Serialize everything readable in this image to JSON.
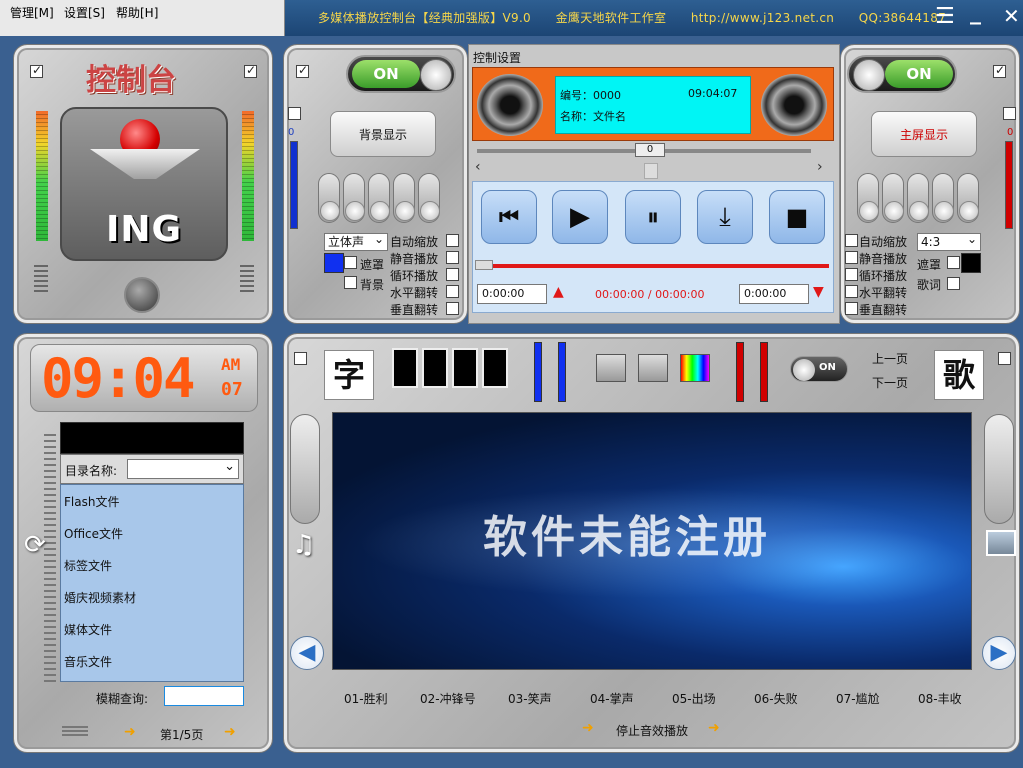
{
  "menu": {
    "manage": "管理[M]",
    "settings": "设置[S]",
    "help": "帮助[H]"
  },
  "title": "多媒体播放控制台【经典加强版】V9.0　　金鹰天地软件工作室　　http://www.j123.net.cn　　QQ:38644187",
  "window_controls": {
    "menu": "☰",
    "minimize": "_",
    "close": "✕"
  },
  "console": {
    "title": "控制台",
    "logo_text": "ING"
  },
  "master": {
    "toggle_left": "ON",
    "toggle_right": "ON",
    "bg_display": "背景显示",
    "main_display": "主屏显示",
    "vol_left": "0",
    "vol_right": "0"
  },
  "control_settings": {
    "tab_label": "控制设置",
    "number_label": "编号：0000",
    "time_display": "09:04:07",
    "name_label": "名称：文件名",
    "seek_value": "0",
    "progress_text": "00:00:00 / 00:00:00",
    "start_time": "0:00:00",
    "end_time": "0:00:00",
    "scroll_left": "‹",
    "scroll_right": "›",
    "transport": {
      "prev": "⏮",
      "play": "▶",
      "pause": "⏸",
      "download": "⤓",
      "stop": "■"
    }
  },
  "left_options": {
    "audio_mode": "立体声",
    "mask": "遮罩",
    "background": "背景",
    "auto_zoom": "自动缩放",
    "mute": "静音播放",
    "loop": "循环播放",
    "flip_h": "水平翻转",
    "flip_v": "垂直翻转"
  },
  "right_options": {
    "aspect": "4:3",
    "mask": "遮罩",
    "lyrics": "歌词",
    "auto_zoom": "自动缩放",
    "mute": "静音播放",
    "loop": "循环播放",
    "flip_h": "水平翻转",
    "flip_v": "垂直翻转"
  },
  "clock": {
    "time": "09:04",
    "ampm": "AM",
    "seconds": "07"
  },
  "directory": {
    "label": "目录名称:",
    "items": [
      "Flash文件",
      "Office文件",
      "标签文件",
      "婚庆视频素材",
      "媒体文件",
      "音乐文件"
    ],
    "search_label": "模糊查询:",
    "page": "第1/5页"
  },
  "stage": {
    "char_left": "字",
    "char_right": "歌",
    "prev_page": "上一页",
    "next_page": "下一页",
    "toggle": "ON",
    "screen_text": "软件未能注册",
    "sfx": [
      "01-胜利",
      "02-冲锋号",
      "03-笑声",
      "04-掌声",
      "05-出场",
      "06-失败",
      "07-尴尬",
      "08-丰收"
    ],
    "stop_sfx": "停止音效播放"
  },
  "colors": {
    "accent_orange": "#e8622a",
    "info_cyan": "#00ffff",
    "clock_orange": "#ff5a10",
    "progress_red": "#e01818",
    "title_yellow": "#f6d64a"
  }
}
